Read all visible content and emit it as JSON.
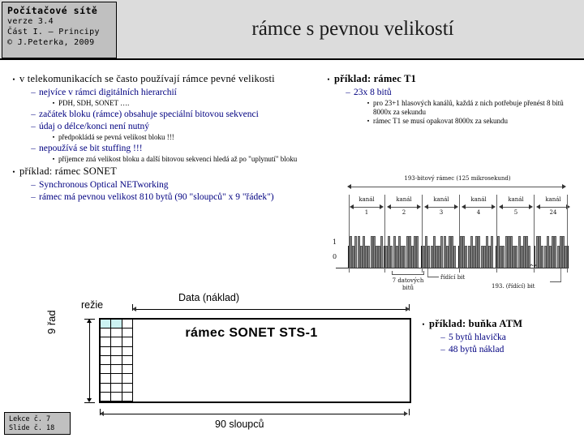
{
  "header": {
    "course_title": "Počítačové sítě",
    "course_lines": [
      "verze 3.4",
      "Část I. – Principy",
      "© J.Peterka, 2009"
    ],
    "slide_title": "rámce s pevnou velikostí"
  },
  "left_column": [
    {
      "level": 1,
      "bullet": "•",
      "text": "v telekomunikacích se často používají rámce pevné velikosti"
    },
    {
      "level": 2,
      "bullet": "–",
      "text": "nejvíce v rámci digitálních hierarchií"
    },
    {
      "level": 3,
      "bullet": "▪",
      "text": "PDH, SDH, SONET …."
    },
    {
      "level": 2,
      "bullet": "–",
      "text": "začátek bloku (rámce) obsahuje speciální bitovou sekvenci"
    },
    {
      "level": 2,
      "bullet": "–",
      "text": "údaj o délce/konci není nutný"
    },
    {
      "level": 3,
      "bullet": "▪",
      "text": "předpokládá se pevná velikost bloku !!!"
    },
    {
      "level": 2,
      "bullet": "–",
      "text": "nepoužívá se bit stuffing !!!"
    },
    {
      "level": 3,
      "bullet": "▪",
      "text": "příjemce zná velikost bloku a další bitovou sekvenci hledá až po \"uplynutí\" bloku"
    },
    {
      "level": 1,
      "bullet": "•",
      "text": "příklad: rámec SONET"
    },
    {
      "level": 2,
      "bullet": "–",
      "text": "Synchronous Optical NETworking"
    },
    {
      "level": 2,
      "bullet": "–",
      "text": "rámec má pevnou velikost 810 bytů (90 \"sloupců\" x 9 \"řádek\")"
    }
  ],
  "right_column": [
    {
      "level": 1,
      "bullet": "•",
      "text": "příklad: rámec T1",
      "bold": true
    },
    {
      "level": 2,
      "bullet": "–",
      "text": "23x 8 bitů"
    },
    {
      "level": 3,
      "bullet": "▪",
      "text": "pro 23+1 hlasových kanálů, každá z nich potřebuje přenést 8 bitů 8000x za sekundu"
    },
    {
      "level": 3,
      "bullet": "▪",
      "text": "rámec T1 se musí opakovat 8000x za sekundu"
    }
  ],
  "atm_block": [
    {
      "level": 1,
      "bullet": "•",
      "text": "příklad: buňka ATM",
      "bold": true
    },
    {
      "level": 2,
      "bullet": "–",
      "text": "5 bytů hlavička"
    },
    {
      "level": 2,
      "bullet": "–",
      "text": "48 bytů náklad"
    }
  ],
  "t1_diagram": {
    "frame_caption": "193-bitový rámec   (125 mikrosekund)",
    "channel_word": "kanál",
    "channels": [
      "1",
      "2",
      "3",
      "4",
      "5",
      "24"
    ],
    "axis_high": "1",
    "axis_low": "0",
    "label_data_bits": "7 datových",
    "label_data_bits2": "bitů",
    "label_control_bit": "řídící bit",
    "label_last_bit": "193. (řídící) bit"
  },
  "sonet_diagram": {
    "overhead_label": "režie",
    "payload_label": "Data (náklad)",
    "rows_label": "9 řad",
    "columns_label": "90 sloupců",
    "frame_label": "rámec SONET STS-1",
    "grid_columns": 3,
    "grid_rows": 9,
    "highlight_cells": 2,
    "highlight_color": "#ccf2f2"
  },
  "footer": {
    "lecture": "Lekce č. 7",
    "slide": "Slide č. 18"
  },
  "colors": {
    "header_band": "#dcdcdc",
    "course_box": "#c0c0c0",
    "sub_text": "#000080",
    "body_text": "#000000",
    "background": "#ffffff"
  }
}
